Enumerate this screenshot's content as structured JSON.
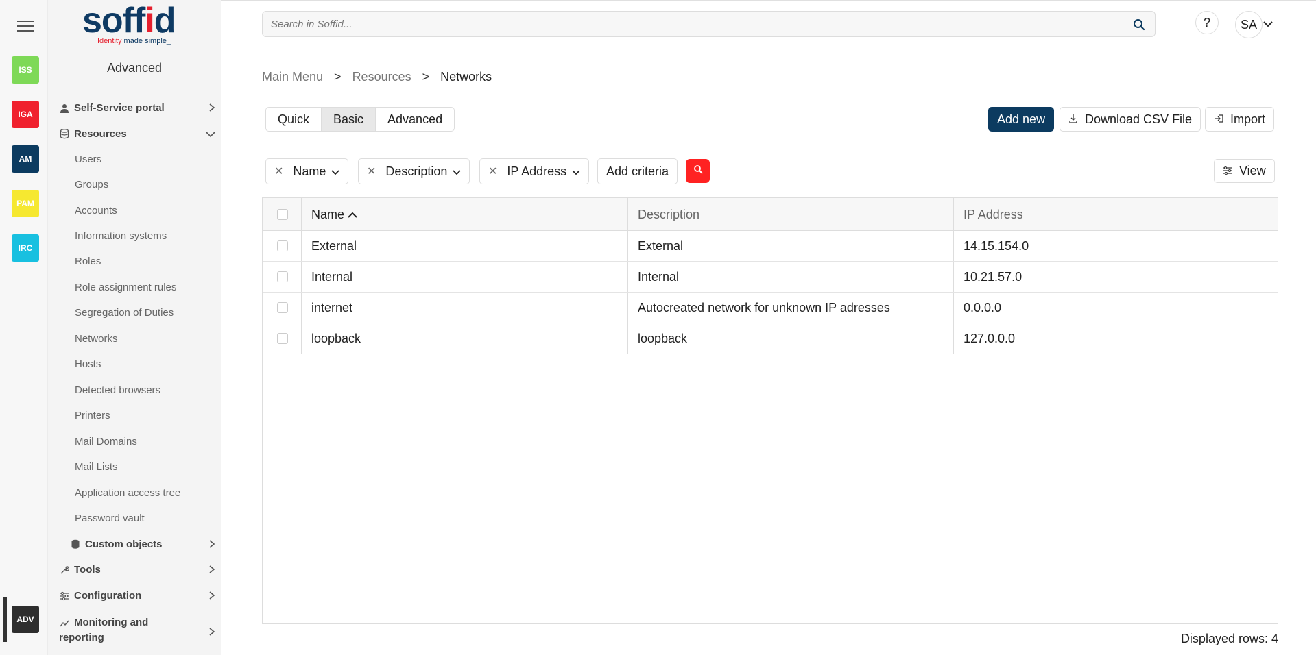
{
  "search": {
    "placeholder": "Search in Soffid..."
  },
  "header": {
    "help": "?",
    "user_initials": "SA"
  },
  "logo": {
    "word_a": "soff",
    "word_b": "i",
    "word_c": "d",
    "tagline_a": "Identity",
    "tagline_b": "made simple_"
  },
  "rail": {
    "apps": [
      {
        "label": "ISS",
        "color": "#7ed957"
      },
      {
        "label": "IGA",
        "color": "#f0212e"
      },
      {
        "label": "AM",
        "color": "#0c3b60"
      },
      {
        "label": "PAM",
        "color": "#f6e830"
      },
      {
        "label": "IRC",
        "color": "#18c0e0"
      },
      {
        "label": "ADV",
        "color": "#2e2e2e"
      }
    ]
  },
  "sidebar": {
    "title": "Advanced",
    "sections": {
      "self_service": "Self-Service portal",
      "resources": "Resources",
      "custom_objects": "Custom objects",
      "tools": "Tools",
      "configuration": "Configuration",
      "monitoring_1": "Monitoring and",
      "monitoring_2": "reporting"
    },
    "items": [
      "Users",
      "Groups",
      "Accounts",
      "Information systems",
      "Roles",
      "Role assignment rules",
      "Segregation of Duties",
      "Networks",
      "Hosts",
      "Detected browsers",
      "Printers",
      "Mail Domains",
      "Mail Lists",
      "Application access tree",
      "Password vault"
    ]
  },
  "breadcrumb": {
    "a": "Main Menu",
    "sep": ">",
    "b": "Resources",
    "c": "Networks"
  },
  "modes": {
    "quick": "Quick",
    "basic": "Basic",
    "advanced": "Advanced"
  },
  "actions": {
    "add_new": "Add new",
    "download_csv": "Download CSV File",
    "import": "Import",
    "view": "View"
  },
  "filters": {
    "name": "Name",
    "description": "Description",
    "ip_address": "IP Address",
    "add_criteria": "Add criteria"
  },
  "table": {
    "columns": {
      "name": "Name",
      "description": "Description",
      "ip": "IP Address"
    },
    "rows": [
      {
        "name": "External",
        "description": "External",
        "ip": "14.15.154.0"
      },
      {
        "name": "Internal",
        "description": "Internal",
        "ip": "10.21.57.0"
      },
      {
        "name": "internet",
        "description": "Autocreated network for unknown IP adresses",
        "ip": "0.0.0.0"
      },
      {
        "name": "loopback",
        "description": "loopback",
        "ip": "127.0.0.0"
      }
    ]
  },
  "footer": {
    "displayed_rows": "Displayed rows: 4"
  }
}
